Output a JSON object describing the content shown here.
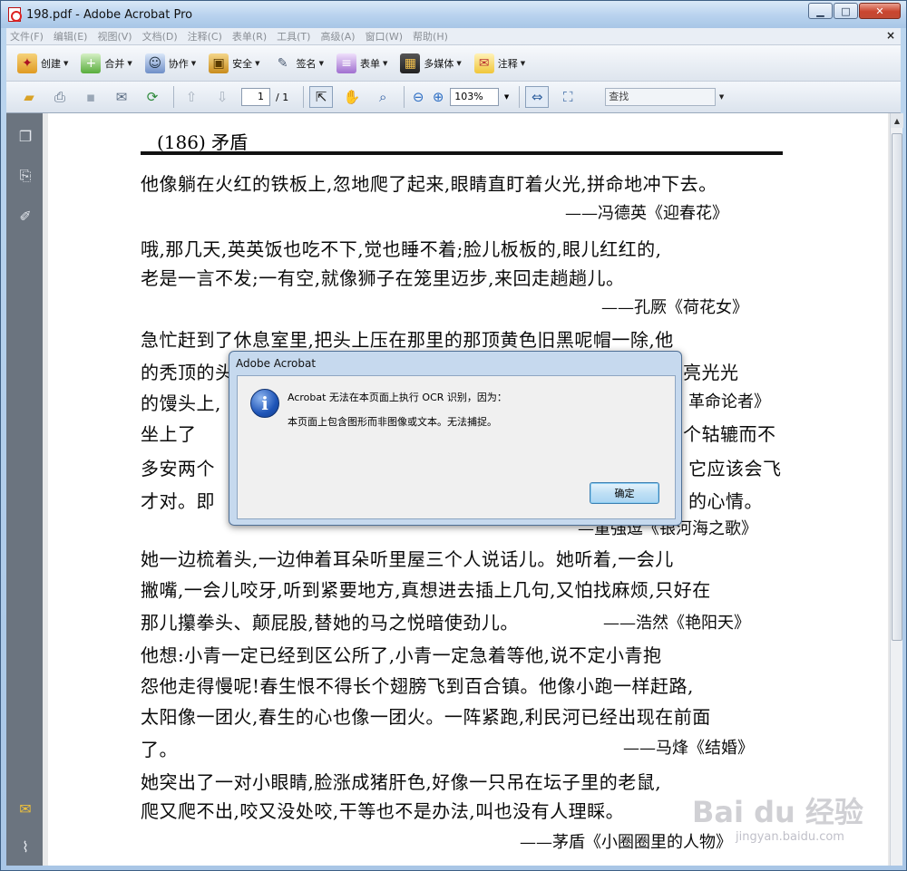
{
  "window": {
    "title": "198.pdf - Adobe Acrobat Pro",
    "minimize": "▁",
    "maximize": "□",
    "close": "✕"
  },
  "menu": {
    "items": [
      "文件(F)",
      "编辑(E)",
      "视图(V)",
      "文档(D)",
      "注释(C)",
      "表单(R)",
      "工具(T)",
      "高级(A)",
      "窗口(W)",
      "帮助(H)"
    ],
    "close_doc": "×"
  },
  "toolbar1": {
    "create": "创建",
    "combine": "合并",
    "collaborate": "协作",
    "secure": "安全",
    "sign": "签名",
    "forms": "表单",
    "multimedia": "多媒体",
    "comment": "注释"
  },
  "toolbar2": {
    "page_current": "1",
    "page_total": "/ 1",
    "zoom": "103%",
    "find_placeholder": "查找"
  },
  "document": {
    "header": "(186)  矛盾",
    "lines": [
      "他像躺在火红的铁板上,忽地爬了起来,眼睛直盯着火光,拼命地冲下去。",
      "——冯德英《迎春花》",
      "    哦,那几天,英英饭也吃不下,觉也睡不着;脸儿板板的,眼儿红红的,",
      "老是一言不发;一有空,就像狮子在笼里迈步,来回走趟趟儿。",
      "——孔厥《荷花女》",
      "    急忙赶到了休息室里,把头上压在那里的那顶黄色旧黑呢帽一除,他",
      "的秃顶的头",
      "亮光光",
      "的馒头上,",
      "革命论者》",
      "    坐上了",
      "个轱辘而不",
      "多安两个",
      "它应该会飞",
      "才对。即",
      "的心情。",
      "—董强逗《银河海之歌》",
      "    她一边梳着头,一边伸着耳朵听里屋三个人说话儿。她听着,一会儿",
      "撇嘴,一会儿咬牙,听到紧要地方,真想进去插上几句,又怕找麻烦,只好在",
      "那儿攥拳头、颠屁股,替她的马之悦暗使劲儿。",
      "——浩然《艳阳天》",
      "    他想:小青一定已经到区公所了,小青一定急着等他,说不定小青抱",
      "怨他走得慢呢!春生恨不得长个翅膀飞到百合镇。他像小跑一样赶路,",
      "太阳像一团火,春生的心也像一团火。一阵紧跑,利民河已经出现在前面",
      "了。",
      "——马烽《结婚》",
      "    她突出了一对小眼睛,脸涨成猪肝色,好像一只吊在坛子里的老鼠,",
      "爬又爬不出,咬又没处咬,干等也不是办法,叫也没有人理睬。",
      "——茅盾《小圈圈里的人物》"
    ]
  },
  "dialog": {
    "title": "Adobe Acrobat",
    "message1": "Acrobat 无法在本页面上执行 OCR 识别，因为：",
    "message2": "本页面上包含图形而非图像或文本。无法捕捉。",
    "ok": "确定",
    "icon": "i"
  },
  "watermark": {
    "brand": "Bai du 经验",
    "url": "jingyan.baidu.com"
  }
}
